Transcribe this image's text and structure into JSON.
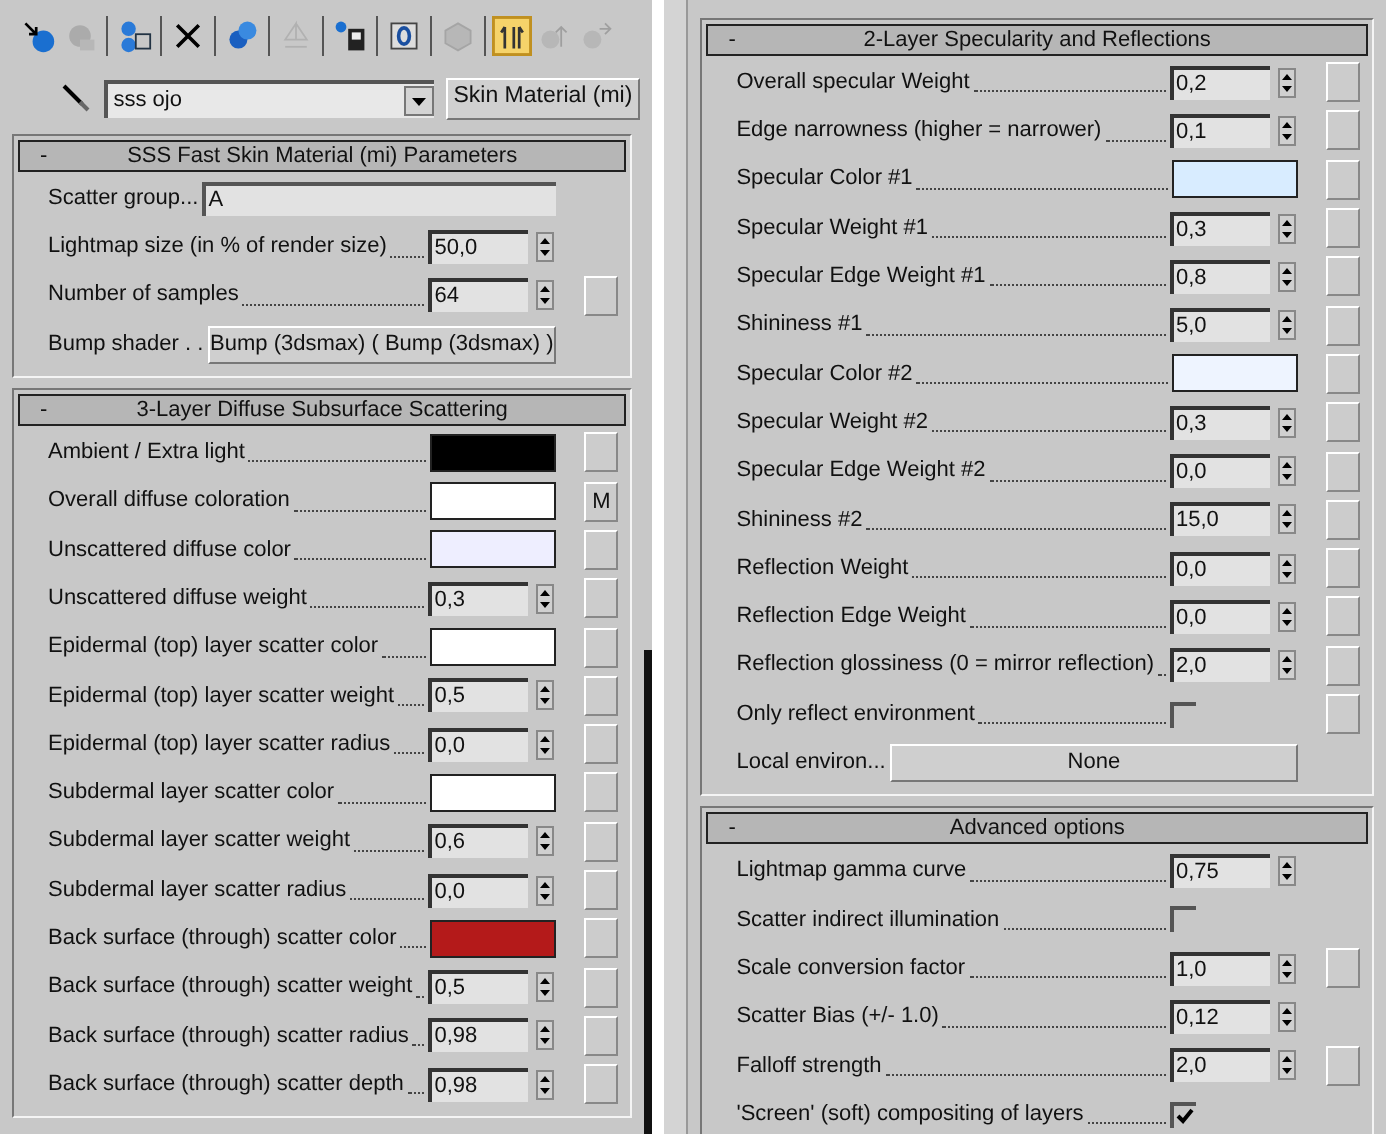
{
  "left_panel": {
    "toolbar": [
      [
        {
          "kind": "get-material",
          "selected": false,
          "disabled": false
        },
        {
          "kind": "put-to-scene",
          "selected": false,
          "disabled": true
        }
      ],
      [
        {
          "kind": "assign",
          "selected": false,
          "disabled": false
        }
      ],
      [
        {
          "kind": "reset",
          "selected": false,
          "disabled": false
        }
      ],
      [
        {
          "kind": "copy",
          "selected": false,
          "disabled": false
        }
      ],
      [
        {
          "kind": "unique",
          "selected": false,
          "disabled": true
        }
      ],
      [
        {
          "kind": "library",
          "selected": false,
          "disabled": false
        }
      ],
      [
        {
          "kind": "material-id",
          "selected": false,
          "disabled": false
        }
      ],
      [
        {
          "kind": "show-map",
          "selected": false,
          "disabled": true
        }
      ],
      [
        {
          "kind": "end-result",
          "selected": true,
          "disabled": false
        },
        {
          "kind": "parent",
          "selected": false,
          "disabled": true
        },
        {
          "kind": "sibling",
          "selected": false,
          "disabled": true
        }
      ]
    ],
    "material_name": "sss ojo",
    "material_type": "Skin Material (mi)",
    "rollouts": [
      {
        "toggle": "-",
        "title": "SSS Fast Skin Material (mi) Parameters",
        "rows": [
          {
            "kind": "text",
            "label": "Scatter group...",
            "value": "A",
            "map": false
          },
          {
            "kind": "spinner",
            "label": "Lightmap size (in % of render size)",
            "value": "50,0",
            "map": false
          },
          {
            "kind": "spinner",
            "label": "Number of samples",
            "value": "64",
            "map": true
          },
          {
            "kind": "button",
            "label": "Bump shader . .",
            "value": "Bump (3dsmax)  ( Bump (3dsmax) )",
            "map": false
          }
        ]
      },
      {
        "toggle": "-",
        "title": "3-Layer Diffuse Subsurface Scattering",
        "rows": [
          {
            "kind": "color",
            "label": "Ambient / Extra light",
            "color": "#000000",
            "map": true
          },
          {
            "kind": "color",
            "label": "Overall diffuse coloration",
            "color": "#ffffff",
            "map": true,
            "map_label": "M"
          },
          {
            "kind": "color",
            "label": "Unscattered diffuse color",
            "color": "#eeeeff",
            "map": true
          },
          {
            "kind": "spinner",
            "label": "Unscattered diffuse weight",
            "value": "0,3",
            "map": true
          },
          {
            "kind": "color",
            "label": "Epidermal (top) layer scatter color",
            "color": "#ffffff",
            "map": true
          },
          {
            "kind": "spinner",
            "label": "Epidermal (top) layer scatter weight",
            "value": "0,5",
            "map": true
          },
          {
            "kind": "spinner",
            "label": "Epidermal (top) layer scatter radius",
            "value": "0,0",
            "map": true
          },
          {
            "kind": "color",
            "label": "Subdermal layer scatter color",
            "color": "#ffffff",
            "map": true
          },
          {
            "kind": "spinner",
            "label": "Subdermal layer scatter weight",
            "value": "0,6",
            "map": true
          },
          {
            "kind": "spinner",
            "label": "Subdermal layer scatter radius",
            "value": "0,0",
            "map": true
          },
          {
            "kind": "color",
            "label": "Back surface (through) scatter color",
            "color": "#b41a1a",
            "map": true
          },
          {
            "kind": "spinner",
            "label": "Back surface (through) scatter weight",
            "value": "0,5",
            "map": true
          },
          {
            "kind": "spinner",
            "label": "Back surface (through) scatter radius",
            "value": "0,98",
            "map": true
          },
          {
            "kind": "spinner",
            "label": "Back surface (through) scatter depth",
            "value": "0,98",
            "map": true
          }
        ]
      }
    ]
  },
  "right_panel": {
    "rollouts": [
      {
        "toggle": "-",
        "title": "2-Layer Specularity and Reflections",
        "rows": [
          {
            "kind": "spinner",
            "label": "Overall specular Weight",
            "value": "0,2",
            "map": true
          },
          {
            "kind": "spinner",
            "label": "Edge narrowness (higher = narrower)",
            "value": "0,1",
            "map": true
          },
          {
            "kind": "color",
            "label": "Specular Color #1",
            "color": "#d8ecff",
            "map": true
          },
          {
            "kind": "spinner",
            "label": "Specular Weight #1",
            "value": "0,3",
            "map": true
          },
          {
            "kind": "spinner",
            "label": "Specular Edge Weight #1",
            "value": "0,8",
            "map": true
          },
          {
            "kind": "spinner",
            "label": "Shininess #1",
            "value": "5,0",
            "map": true
          },
          {
            "kind": "color",
            "label": "Specular Color #2",
            "color": "#eef4ff",
            "map": true
          },
          {
            "kind": "spinner",
            "label": "Specular Weight #2",
            "value": "0,3",
            "map": true
          },
          {
            "kind": "spinner",
            "label": "Specular Edge Weight #2",
            "value": "0,0",
            "map": true
          },
          {
            "kind": "spinner",
            "label": "Shininess #2",
            "value": "15,0",
            "map": true
          },
          {
            "kind": "spinner",
            "label": "Reflection Weight",
            "value": "0,0",
            "map": true
          },
          {
            "kind": "spinner",
            "label": "Reflection Edge Weight",
            "value": "0,0",
            "map": true
          },
          {
            "kind": "spinner",
            "label": "Reflection glossiness (0 = mirror reflection)",
            "value": "2,0",
            "map": true
          },
          {
            "kind": "checkbox",
            "label": "Only reflect environment",
            "checked": false,
            "map": true
          },
          {
            "kind": "button",
            "label": "Local environ...",
            "value": "None",
            "map": false
          }
        ]
      },
      {
        "toggle": "-",
        "title": "Advanced options",
        "rows": [
          {
            "kind": "spinner",
            "label": "Lightmap gamma curve",
            "value": "0,75",
            "map": false
          },
          {
            "kind": "checkbox",
            "label": "Scatter indirect illumination",
            "checked": false,
            "map": false
          },
          {
            "kind": "spinner",
            "label": "Scale conversion factor",
            "value": "1,0",
            "map": true
          },
          {
            "kind": "spinner",
            "label": "Scatter Bias (+/- 1.0)",
            "value": "0,12",
            "map": false
          },
          {
            "kind": "spinner",
            "label": "Falloff strength",
            "value": "2,0",
            "map": true
          },
          {
            "kind": "checkbox",
            "label": "'Screen' (soft) compositing of layers",
            "checked": true,
            "map": false
          }
        ]
      }
    ]
  }
}
